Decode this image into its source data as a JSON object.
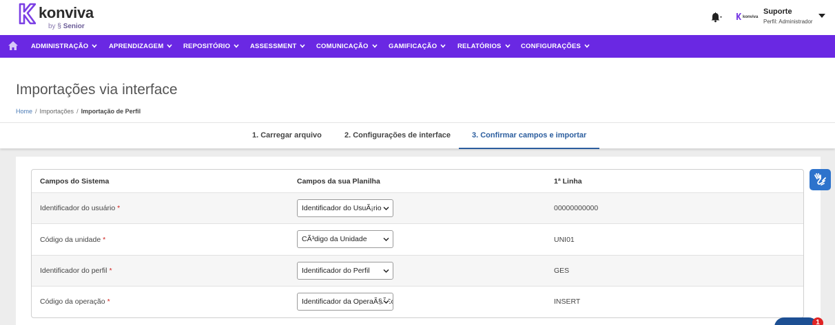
{
  "brand": {
    "name": "konviva",
    "by": "by",
    "company": "Senior"
  },
  "user": {
    "name": "Suporte",
    "role": "Perfil: Administrador",
    "logo_text": "konviva"
  },
  "nav": {
    "items": [
      {
        "label": "ADMINISTRAÇÃO"
      },
      {
        "label": "APRENDIZAGEM"
      },
      {
        "label": "REPOSITÓRIO"
      },
      {
        "label": "ASSESSMENT"
      },
      {
        "label": "COMUNICAÇÃO"
      },
      {
        "label": "GAMIFICAÇÃO"
      },
      {
        "label": "RELATÓRIOS"
      },
      {
        "label": "CONFIGURAÇÕES"
      }
    ]
  },
  "page": {
    "title": "Importações via interface",
    "breadcrumb": {
      "home": "Home",
      "parent": "Importações",
      "current": "Importação de Perfil",
      "separator": "/"
    }
  },
  "steps": [
    {
      "label": "1. Carregar arquivo"
    },
    {
      "label": "2. Configurações de interface"
    },
    {
      "label": "3. Confirmar campos e importar"
    }
  ],
  "table": {
    "headers": {
      "system": "Campos do Sistema",
      "sheet": "Campos da sua Planilha",
      "first_line": "1ª Linha"
    },
    "rows": [
      {
        "field": "Identificador do usuário",
        "required": "*",
        "mapped": "Identificador do UsuÃ¡rio",
        "value": "00000000000"
      },
      {
        "field": "Código da unidade",
        "required": "*",
        "mapped": "CÃ³digo da Unidade",
        "value": "UNI01"
      },
      {
        "field": "Identificador do perfil",
        "required": "*",
        "mapped": "Identificador do Perfil",
        "value": "GES"
      },
      {
        "field": "Código da operação",
        "required": "*",
        "mapped": "Identificador da OperaÃ§Ã£o",
        "value": "INSERT"
      }
    ]
  },
  "chat": {
    "badge": "1"
  },
  "colors": {
    "nav": "#6a28e3",
    "accent": "#2b5d9e",
    "required": "#d0231f",
    "a11y": "#2d73cc"
  }
}
